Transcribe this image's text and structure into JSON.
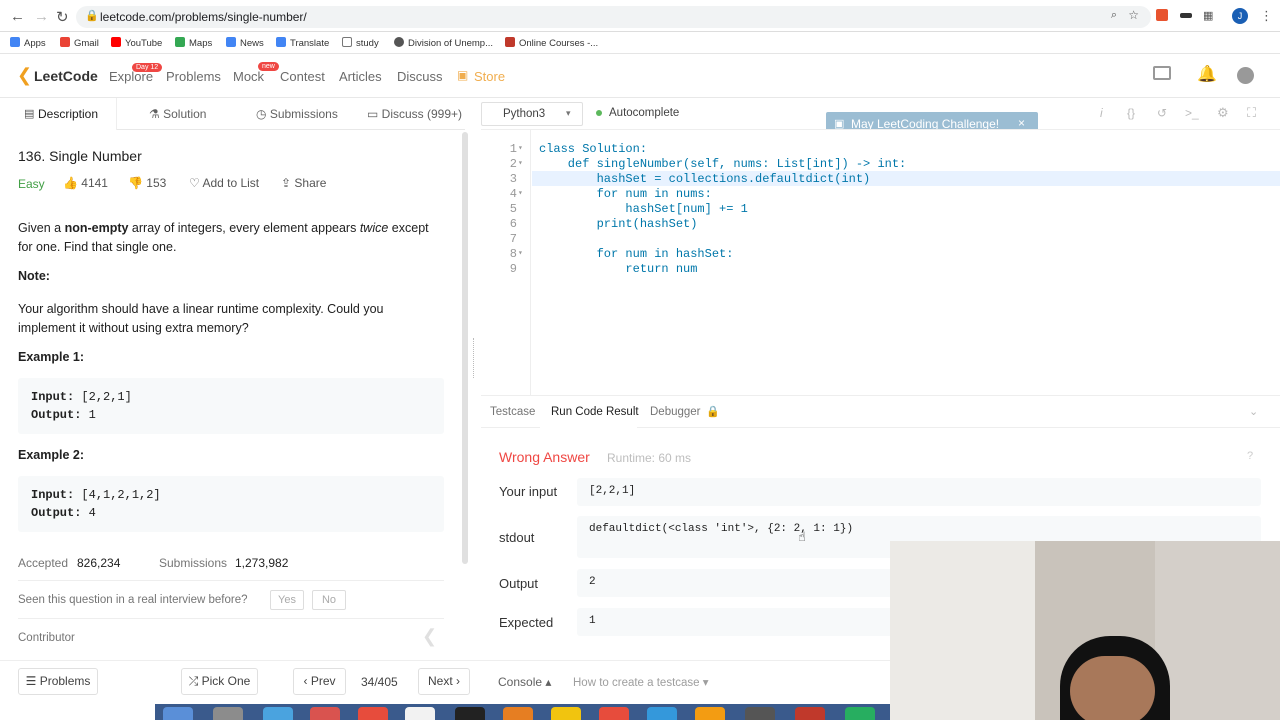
{
  "browser": {
    "url": "leetcode.com/problems/single-number/",
    "bookmarks": [
      "Apps",
      "Gmail",
      "YouTube",
      "Maps",
      "News",
      "Translate",
      "study",
      "Division of Unemp...",
      "Online Courses -..."
    ]
  },
  "nav": {
    "logo": "LeetCode",
    "items": [
      "Explore",
      "Problems",
      "Mock",
      "Contest",
      "Articles",
      "Discuss",
      "Store"
    ],
    "explore_badge": "Day 12",
    "mock_badge": "new",
    "challenge": "May LeetCoding Challenge!"
  },
  "tabs": [
    "Description",
    "Solution",
    "Submissions",
    "Discuss (999+)"
  ],
  "problem": {
    "title": "136. Single Number",
    "difficulty": "Easy",
    "likes": "4141",
    "dislikes": "153",
    "add_to_list": "Add to List",
    "share": "Share",
    "p1_a": "Given a ",
    "p1_b": "non-empty",
    "p1_c": " array of integers, every element appears ",
    "p1_d": "twice",
    "p1_e": " except",
    "p1_f": "for one. Find that single one.",
    "note": "Note:",
    "note_l1": "Your algorithm should have a linear runtime complexity. Could you",
    "note_l2": "implement it without using extra memory?",
    "ex1_title": "Example 1:",
    "ex1_input_label": "Input:",
    "ex1_input": "[2,2,1]",
    "ex1_output_label": "Output:",
    "ex1_output": "1",
    "ex2_title": "Example 2:",
    "ex2_input_label": "Input:",
    "ex2_input": "[4,1,2,1,2]",
    "ex2_output_label": "Output:",
    "ex2_output": "4",
    "accepted_label": "Accepted",
    "accepted": "826,234",
    "submissions_label": "Submissions",
    "submissions": "1,273,982",
    "interview_q": "Seen this question in a real interview before?",
    "yes": "Yes",
    "no": "No",
    "contributor": "Contributor"
  },
  "bottom": {
    "problems": "Problems",
    "pick_one": "Pick One",
    "prev": "Prev",
    "page": "34/405",
    "next": "Next",
    "console": "Console",
    "testcase_help": "How to create a testcase"
  },
  "editor": {
    "language": "Python3",
    "autocomplete": "Autocomplete",
    "line_numbers": [
      "1",
      "2",
      "3",
      "4",
      "5",
      "6",
      "7",
      "8",
      "9"
    ],
    "lines": [
      "class Solution:",
      "    def singleNumber(self, nums: List[int]) -> int:",
      "        hashSet = collections.defaultdict(int)",
      "        for num in nums:",
      "            hashSet[num] += 1",
      "        print(hashSet)",
      "",
      "        for num in hashSet:",
      "            return num"
    ]
  },
  "result_tabs": [
    "Testcase",
    "Run Code Result",
    "Debugger"
  ],
  "result": {
    "status": "Wrong Answer",
    "runtime": "Runtime: 60 ms",
    "your_input_label": "Your input",
    "your_input": "[2,2,1]",
    "stdout_label": "stdout",
    "stdout": "defaultdict(<class 'int'>, {2: 2, 1: 1})",
    "output_label": "Output",
    "output": "2",
    "expected_label": "Expected",
    "expected": "1"
  },
  "colors": {
    "wrong": "#ef4743",
    "easy": "#43a047",
    "store": "#f0ad4e",
    "autocomplete_dot": "#5cb85c"
  }
}
